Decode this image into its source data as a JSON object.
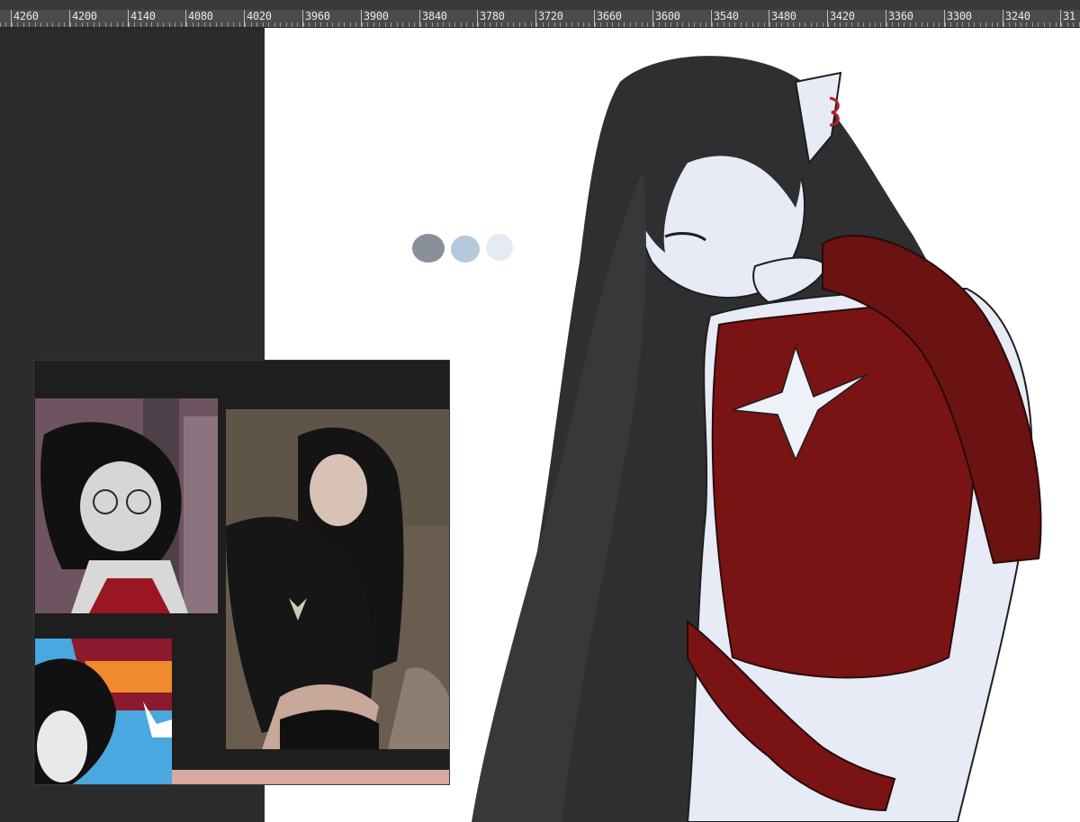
{
  "ruler": {
    "labels": [
      "4260",
      "4200",
      "4140",
      "4080",
      "4020",
      "3960",
      "3900",
      "3840",
      "3780",
      "3720",
      "3660",
      "3600",
      "3540",
      "3480",
      "3420",
      "3360",
      "3300",
      "3240",
      "31"
    ]
  },
  "canvas": {
    "background": "#ffffff",
    "swatches": [
      "#8a9099",
      "#b5c8dc",
      "#e4ebf2"
    ]
  },
  "reference_board": {
    "panels": [
      "cartoon-character-with-glasses",
      "photo-reference-black-outfit",
      "cartoon-character-rainbow-background"
    ]
  },
  "colors": {
    "workspace": "#2b2b2b",
    "ruler": "#4b4b4b",
    "hair": "#2f2f31",
    "skin": "#e7ebf5",
    "outfit": "#7a1414"
  }
}
